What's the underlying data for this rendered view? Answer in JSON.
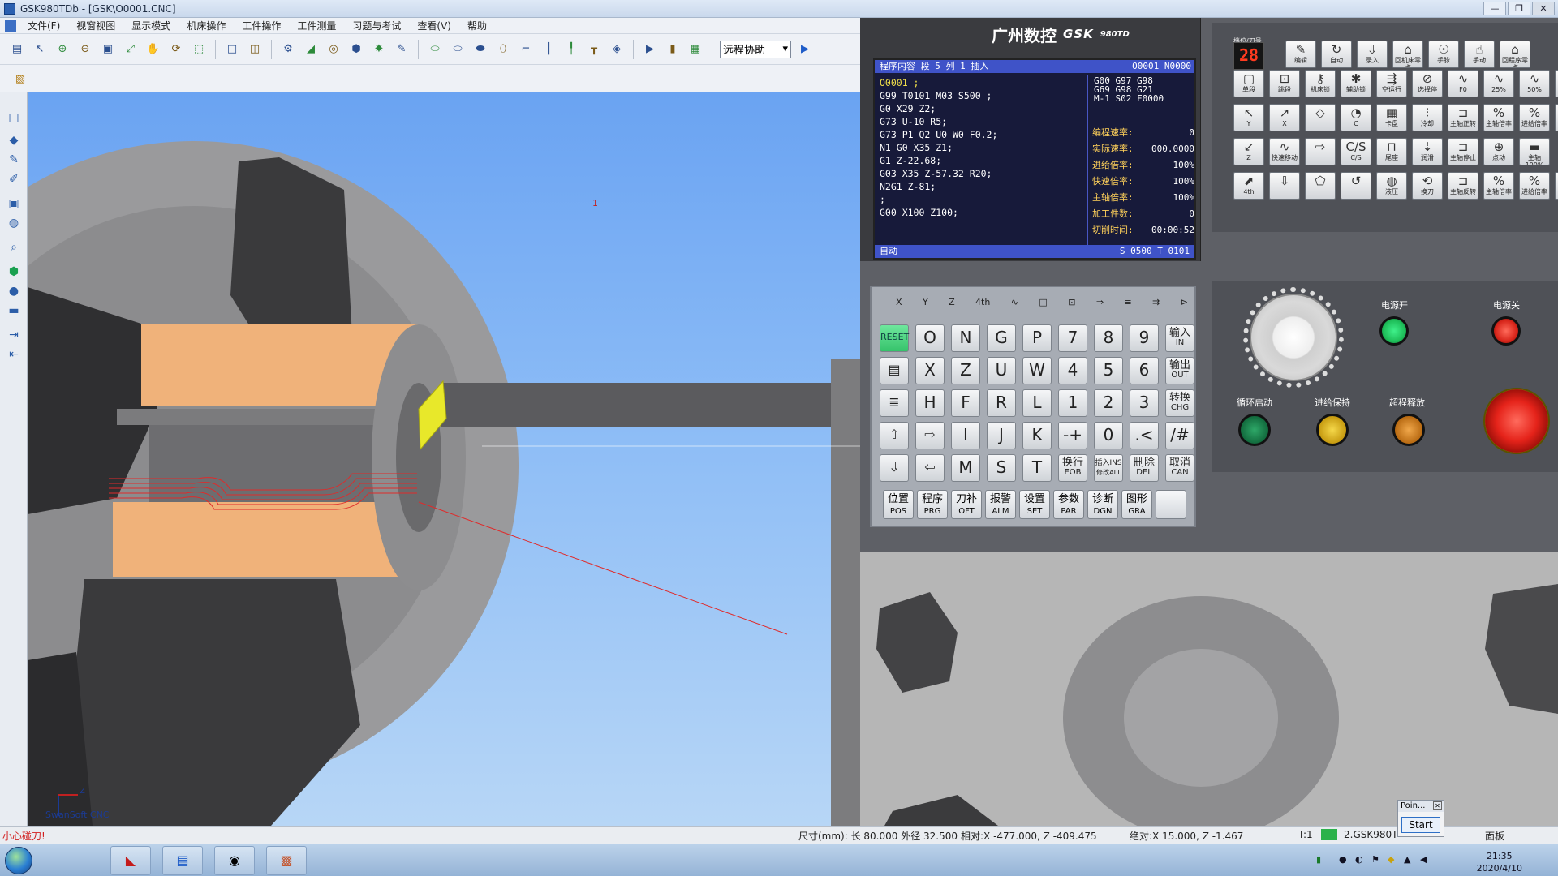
{
  "window": {
    "title": "GSK980TDb - [GSK\\O0001.CNC]"
  },
  "menu": [
    "文件(F)",
    "视窗视图",
    "显示模式",
    "机床操作",
    "工件操作",
    "工件测量",
    "习题与考试",
    "查看(V)",
    "帮助"
  ],
  "toolbar": {
    "remote_assist": "远程协助"
  },
  "viewport": {
    "marker": "1",
    "caption": "SwanSoft CNC",
    "axis_z": "Z",
    "axis_x": "X"
  },
  "cnc": {
    "brand": "广州数控",
    "gsk": "GSK",
    "model": "980TD",
    "lcd": {
      "header_left": "程序内容   段 5  列 1  插入",
      "header_right": "O0001 N0000",
      "program": [
        "O0001 ;",
        "G99 T0101 M03 S500 ;",
        "G0 X29 Z2;",
        "G73 U-10 R5;",
        "G73 P1 Q2 U0 W0 F0.2;",
        "N1 G0 X35 Z1;",
        "G1 Z-22.68;",
        "G03 X35 Z-57.32 R20;",
        "N2G1 Z-81;",
        ";",
        "G00 X100 Z100;"
      ],
      "modal": [
        "G00 G97 G98",
        "G69 G98 G21",
        "M-1  S02 F0000"
      ],
      "rates": [
        {
          "k": "编程速率:",
          "v": "0"
        },
        {
          "k": "实际速率:",
          "v": "000.0000"
        },
        {
          "k": "进给倍率:",
          "v": "100%"
        },
        {
          "k": "快速倍率:",
          "v": "100%"
        },
        {
          "k": "主轴倍率:",
          "v": "100%"
        },
        {
          "k": "加工件数:",
          "v": "0"
        },
        {
          "k": "切削时间:",
          "v": "00:00:52"
        }
      ],
      "footer_mode": "自动",
      "footer_st": "S 0500  T 0101"
    },
    "axis_keys": [
      "X",
      "Y",
      "Z",
      "4th",
      "∿",
      "□",
      "⊡",
      "⇒",
      "≡",
      "⇉",
      "⊳"
    ],
    "keys": {
      "reset": "RESET",
      "r1": [
        "O",
        "N",
        "G",
        "P",
        "7",
        "8",
        "9"
      ],
      "r1_sub": [
        "",
        "",
        "",
        "Q",
        "",
        "",
        ""
      ],
      "in_top": "输入",
      "in_bot": "IN",
      "r2": [
        "X",
        "Z",
        "U",
        "W",
        "4",
        "5",
        "6"
      ],
      "out_top": "输出",
      "out_bot": "OUT",
      "r3": [
        "H",
        "F",
        "R",
        "L",
        "1",
        "2",
        "3"
      ],
      "r3_sub": [
        "",
        "E",
        "V",
        "D",
        "",
        "",
        ""
      ],
      "chg_top": "转换",
      "chg_bot": "CHG",
      "r4": [
        "I",
        "J",
        "K",
        "-+",
        "0",
        ".<",
        "/#"
      ],
      "r4_sub": [
        "A",
        "B",
        "C",
        "",
        "",
        "",
        ""
      ],
      "r5": [
        "M",
        "S",
        "T"
      ],
      "r5_sub": [
        "[",
        "]",
        "="
      ],
      "eob_top": "换行",
      "eob_bot": "EOB",
      "ins_top": "插入INS",
      "ins_bot": "修改ALT",
      "del_top": "删除",
      "del_bot": "DEL",
      "can_top": "取消",
      "can_bot": "CAN"
    },
    "func_keys": [
      {
        "t": "位置",
        "b": "POS"
      },
      {
        "t": "程序",
        "b": "PRG"
      },
      {
        "t": "刀补",
        "b": "OFT"
      },
      {
        "t": "报警",
        "b": "ALM"
      },
      {
        "t": "设置",
        "b": "SET"
      },
      {
        "t": "参数",
        "b": "PAR"
      },
      {
        "t": "诊断",
        "b": "DGN"
      },
      {
        "t": "图形",
        "b": "GRA"
      }
    ],
    "tool_display_label": "档位/刀号",
    "tool_display": "28",
    "machine_buttons": [
      "编辑",
      "自动",
      "录入",
      "回机床零点",
      "手脉",
      "手动",
      "回程序零点",
      "单段",
      "跳段",
      "机床锁",
      "辅助锁",
      "空运行",
      "选择停",
      "F0",
      "25%",
      "50%",
      "",
      "Y",
      "X",
      "",
      "C",
      "卡盘",
      "冷却",
      "主轴正转",
      "主轴倍率",
      "进给倍率",
      "",
      "Z",
      "快速移动",
      "",
      "C/S",
      "尾座",
      "润滑",
      "主轴停止",
      "点动",
      "主轴100%",
      "4th",
      "",
      "",
      "",
      "液压",
      "换刀",
      "主轴反转",
      "主轴倍率",
      "进给倍率",
      ""
    ],
    "ctrl": {
      "power_on": "电源开",
      "power_off": "电源关",
      "cycle_start": "循环启动",
      "feed_hold": "进给保持",
      "overtravel": "超程释放"
    }
  },
  "status": {
    "warn": "小心碰刀!",
    "dims": "尺寸(mm): 长  80.000 外径   32.500",
    "rel": "相对:X -477.000, Z -409.475",
    "abs": "绝对:X   15.000, Z   -1.467",
    "t": "T:1",
    "task": "2.GSK980T",
    "panel": "面板"
  },
  "point_dialog": {
    "title": "Poin...",
    "start": "Start"
  },
  "taskbar": {
    "time": "21:35",
    "date": "2020/4/10"
  },
  "colors": {
    "workpiece": "#f0b27a",
    "tool": "#e8e82a",
    "sky": "#8cbcf6",
    "reset": "#3fd079",
    "power_on": "#1fbf5a",
    "power_off": "#d8261b",
    "estop": "#e5231a"
  }
}
